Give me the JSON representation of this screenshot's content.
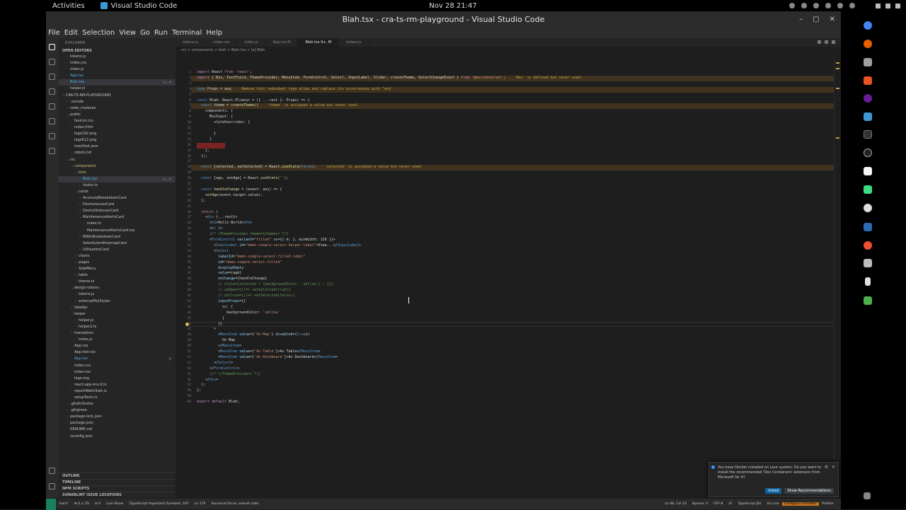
{
  "topbar": {
    "activities": "Activities",
    "app_name": "Visual Studio Code",
    "clock": "Nov 28  21:47"
  },
  "window": {
    "title": "Blah.tsx - cra-ts-rm-playground - Visual Studio Code",
    "menu": [
      "File",
      "Edit",
      "Selection",
      "View",
      "Go",
      "Run",
      "Terminal",
      "Help"
    ]
  },
  "sidebar": {
    "title": "EXPLORER",
    "open_editors": "OPEN EDITORS",
    "project": "CRA-TS-RM-PLAYGROUND",
    "tree": [
      {
        "name": "tokens.js",
        "indent": 1,
        "cls": ""
      },
      {
        "name": "index.css",
        "indent": 1,
        "cls": ""
      },
      {
        "name": "index.js",
        "indent": 1,
        "cls": ""
      },
      {
        "name": "App.tsx",
        "indent": 1,
        "cls": "tsx"
      },
      {
        "name": "Blah.tsx",
        "indent": 1,
        "cls": "tsx sel",
        "badge": "9+, M"
      },
      {
        "name": "helper.js",
        "indent": 1,
        "cls": ""
      },
      {
        "name": "CRA-TS-RM-PLAYGROUND",
        "indent": 0,
        "cls": "",
        "tw": "v"
      },
      {
        "name": ".vscode",
        "indent": 1,
        "cls": "",
        "tw": ">"
      },
      {
        "name": "node_modules",
        "indent": 1,
        "cls": "",
        "tw": ">"
      },
      {
        "name": "public",
        "indent": 1,
        "cls": "",
        "tw": "v"
      },
      {
        "name": "favicon.ico",
        "indent": 2,
        "cls": ""
      },
      {
        "name": "index.html",
        "indent": 2,
        "cls": ""
      },
      {
        "name": "logo192.png",
        "indent": 2,
        "cls": ""
      },
      {
        "name": "logo512.png",
        "indent": 2,
        "cls": ""
      },
      {
        "name": "manifest.json",
        "indent": 2,
        "cls": ""
      },
      {
        "name": "robots.txt",
        "indent": 2,
        "cls": ""
      },
      {
        "name": "src",
        "indent": 1,
        "cls": "mod",
        "tw": "v"
      },
      {
        "name": "components",
        "indent": 2,
        "cls": "mod",
        "tw": "v"
      },
      {
        "name": "blah",
        "indent": 3,
        "cls": "mod",
        "tw": "v"
      },
      {
        "name": "Blah.tsx",
        "indent": 4,
        "cls": "tsx sel",
        "badge": "9+, M"
      },
      {
        "name": "hooks.ts",
        "indent": 4,
        "cls": ""
      },
      {
        "name": "cards",
        "indent": 3,
        "cls": "",
        "tw": "v"
      },
      {
        "name": "AnomalyBreakdownCard",
        "indent": 4,
        "cls": "",
        "tw": ">"
      },
      {
        "name": "DeviceIssuesCard",
        "indent": 4,
        "cls": "",
        "tw": ">"
      },
      {
        "name": "DeviceStatusesCard",
        "indent": 4,
        "cls": "",
        "tw": ">"
      },
      {
        "name": "MaintenanceAlertsCard",
        "indent": 4,
        "cls": "",
        "tw": "v"
      },
      {
        "name": "index.ts",
        "indent": 5,
        "cls": ""
      },
      {
        "name": "MaintenanceAlertsCard.tsx",
        "indent": 5,
        "cls": ""
      },
      {
        "name": "NWInBreakdownCard",
        "indent": 4,
        "cls": "",
        "tw": ">"
      },
      {
        "name": "SalesSubmitteamapCard",
        "indent": 4,
        "cls": "",
        "tw": ">"
      },
      {
        "name": "UtilisationCard",
        "indent": 4,
        "cls": "",
        "tw": ">"
      },
      {
        "name": "charts",
        "indent": 3,
        "cls": "",
        "tw": ">"
      },
      {
        "name": "pages",
        "indent": 3,
        "cls": "",
        "tw": ">"
      },
      {
        "name": "SideMenu",
        "indent": 3,
        "cls": "",
        "tw": ">"
      },
      {
        "name": "table",
        "indent": 3,
        "cls": "",
        "tw": ">"
      },
      {
        "name": "theme.ts",
        "indent": 3,
        "cls": ""
      },
      {
        "name": "design-tokens",
        "indent": 2,
        "cls": "",
        "tw": "v"
      },
      {
        "name": "tokens.js",
        "indent": 3,
        "cls": ""
      },
      {
        "name": "externalMuiStyles",
        "indent": 3,
        "cls": "",
        "tw": ">"
      },
      {
        "name": "fakeApi",
        "indent": 2,
        "cls": "",
        "tw": ">"
      },
      {
        "name": "helper",
        "indent": 2,
        "cls": "",
        "tw": "v"
      },
      {
        "name": "helper.js",
        "indent": 3,
        "cls": ""
      },
      {
        "name": "helper2.ts",
        "indent": 3,
        "cls": ""
      },
      {
        "name": "translation",
        "indent": 2,
        "cls": "",
        "tw": ">"
      },
      {
        "name": "index.js",
        "indent": 3,
        "cls": ""
      },
      {
        "name": "App.css",
        "indent": 2,
        "cls": ""
      },
      {
        "name": "App.test.tsx",
        "indent": 2,
        "cls": ""
      },
      {
        "name": "App.tsx",
        "indent": 2,
        "cls": "tsx",
        "badge": "M"
      },
      {
        "name": "index.css",
        "indent": 2,
        "cls": ""
      },
      {
        "name": "index.tsx",
        "indent": 2,
        "cls": ""
      },
      {
        "name": "logo.svg",
        "indent": 2,
        "cls": ""
      },
      {
        "name": "react-app-env.d.ts",
        "indent": 2,
        "cls": ""
      },
      {
        "name": "reportWebVitals.ts",
        "indent": 2,
        "cls": ""
      },
      {
        "name": "setupTests.ts",
        "indent": 2,
        "cls": ""
      },
      {
        "name": ".gitattributes",
        "indent": 1,
        "cls": ""
      },
      {
        "name": ".gitignore",
        "indent": 1,
        "cls": ""
      },
      {
        "name": "package-lock.json",
        "indent": 1,
        "cls": ""
      },
      {
        "name": "package.json",
        "indent": 1,
        "cls": ""
      },
      {
        "name": "README.md",
        "indent": 1,
        "cls": ""
      },
      {
        "name": "tsconfig.json",
        "indent": 1,
        "cls": ""
      }
    ],
    "bottom_sections": [
      "OUTLINE",
      "TIMELINE",
      "NPM SCRIPTS",
      "SONARLINT ISSUE LOCATIONS"
    ]
  },
  "tabs": [
    {
      "label": "tokens.js",
      "active": false
    },
    {
      "label": "index.css",
      "active": false
    },
    {
      "label": "index.js",
      "active": false
    },
    {
      "label": "App.tsx M",
      "active": false
    },
    {
      "label": "Blah.tsx 9+, M",
      "active": true
    },
    {
      "label": "helper.js",
      "active": false
    }
  ],
  "breadcrumb": "src > components > blah > Blah.tsx > [e] Blah",
  "code": [
    {
      "n": 1,
      "html": "<span class='kw'>import</span> React <span class='kw'>from</span> <span class='str'>'react'</span>;"
    },
    {
      "n": 2,
      "warn": true,
      "html": "<span class='kw'>import</span> { Box, TextField, ThemeProvider, MenuItem, FormControl, Select, InputLabel, Slider, createTheme, SelectChangeEvent } <span class='kw'>from</span> <span class='str'>'@mui/material'</span>;    <span class='hint'>'Box' is defined but never used.</span>"
    },
    {
      "n": 3,
      "html": ""
    },
    {
      "n": 4,
      "warn": true,
      "html": "<span class='tag'>type</span> Props = any;    <span class='hint'>Remove this redundant type alias and replace its occurrences with \"any\"</span>"
    },
    {
      "n": 5,
      "html": ""
    },
    {
      "n": 6,
      "html": "<span class='tag'>const</span> <span class='fn'>Blah</span>: React.FC&lt;any&gt; = ({ ...rest }: Props) =&gt; {"
    },
    {
      "n": 7,
      "warn": true,
      "html": "  <span class='tag'>const</span> theme = <span class='fn'>createTheme</span>({    <span class='hint'>'theme' is assigned a value but never used.</span>"
    },
    {
      "n": 8,
      "html": "    components: {"
    },
    {
      "n": 9,
      "html": "      MuiInput: {"
    },
    {
      "n": 10,
      "html": "        styleOverrides: {"
    },
    {
      "n": 11,
      "html": ""
    },
    {
      "n": 12,
      "html": "        }"
    },
    {
      "n": 13,
      "html": "      }"
    },
    {
      "n": 14,
      "err": true,
      "html": ""
    },
    {
      "n": 15,
      "html": "    },"
    },
    {
      "n": 16,
      "html": "  });"
    },
    {
      "n": 17,
      "html": ""
    },
    {
      "n": 18,
      "warn": true,
      "html": "  <span class='tag'>const</span> [selected, setSelected] = React.<span class='fn'>useState</span>(<span class='tag'>false</span>);    <span class='hint'>'selected' is assigned a value but never used.</span>"
    },
    {
      "n": 19,
      "html": ""
    },
    {
      "n": 20,
      "html": "  <span class='tag'>const</span> [age, setAge] = React.<span class='fn'>useState</span>(<span class='str'>''</span>);"
    },
    {
      "n": 21,
      "html": ""
    },
    {
      "n": 22,
      "html": "  <span class='tag'>const</span> <span class='fn'>handleChange</span> = (event: any) =&gt; {"
    },
    {
      "n": 23,
      "html": "    <span class='fn'>setAge</span>(event.target.value);"
    },
    {
      "n": 24,
      "html": "  };"
    },
    {
      "n": 25,
      "html": ""
    },
    {
      "n": 26,
      "html": "  <span class='kw'>return</span> ("
    },
    {
      "n": 27,
      "html": "    &lt;<span class='tag'>div</span> {...rest}&gt;"
    },
    {
      "n": 28,
      "html": "      &lt;<span class='tag'>h1</span>&gt;Hello World&lt;/<span class='tag'>h1</span>&gt;"
    },
    {
      "n": 29,
      "html": "      &lt;<span class='tag'>br</span> /&gt;"
    },
    {
      "n": 30,
      "html": "      <span class='cmt'>{/* &lt;ThemeProvider theme={theme}&gt; */}</span>"
    },
    {
      "n": 31,
      "html": "      &lt;<span class='tag'>FormControl</span> <span class='var'>variant</span>=<span class='str'>\"filled\"</span> <span class='var'>sx</span>={{ m: 1, minWidth: 120 }}&gt;"
    },
    {
      "n": 32,
      "html": "        &lt;<span class='tag'>InputLabel</span> <span class='var'>id</span>=<span class='str'>\"demo-simple-select-helper-label\"</span>&gt;View...&lt;/<span class='tag'>InputLabel</span>&gt;"
    },
    {
      "n": 33,
      "html": "        &lt;<span class='tag'>Select</span>"
    },
    {
      "n": 34,
      "html": "          <span class='var'>labelId</span>=<span class='str'>\"demo-simple-select-filled-label\"</span>"
    },
    {
      "n": 35,
      "html": "          <span class='var'>id</span>=<span class='str'>\"demo-simple-select-filled\"</span>"
    },
    {
      "n": 36,
      "html": "          <span class='var'>displayEmpty</span>"
    },
    {
      "n": 37,
      "html": "          <span class='var'>value</span>={age}"
    },
    {
      "n": 38,
      "html": "          <span class='var'>onChange</span>={handleChange}"
    },
    {
      "n": 39,
      "html": "          <span class='cmt'>// style={selected ? {backgroundColor: 'yellow'} : {}}</span>"
    },
    {
      "n": 40,
      "html": "          <span class='cmt'>// onOpen={()=&gt; setSelected(true)}</span>"
    },
    {
      "n": 41,
      "html": "          <span class='cmt'>// onClose={()=&gt; setSelected(false)}</span>"
    },
    {
      "n": 42,
      "html": "          <span class='var'>inputProps</span>={{"
    },
    {
      "n": 43,
      "html": "            sx: {"
    },
    {
      "n": 44,
      "html": "              backgroundColor: <span class='str'>'yellow'</span>"
    },
    {
      "n": 45,
      "html": "            }"
    },
    {
      "n": 46,
      "cur": true,
      "html": "          }}"
    },
    {
      "n": 47,
      "html": "        &gt;"
    },
    {
      "n": 48,
      "html": "          &lt;<span class='tag'>MenuItem</span> <span class='var'>value</span>={<span class='str'>'On Map'</span>} <span class='var'>disabled</span>={<span class='tag'>true</span>}&gt;"
    },
    {
      "n": 49,
      "html": "            On Map"
    },
    {
      "n": 50,
      "html": "          &lt;/<span class='tag'>MenuItem</span>&gt;"
    },
    {
      "n": 51,
      "html": "          &lt;<span class='tag'>MenuItem</span> <span class='var'>value</span>={<span class='str'>'As Table'</span>}&gt;As Table&lt;/<span class='tag'>MenuItem</span>&gt;"
    },
    {
      "n": 52,
      "html": "          &lt;<span class='tag'>MenuItem</span> <span class='var'>value</span>={<span class='str'>'As Dashboard'</span>}&gt;As Dashboard&lt;/<span class='tag'>MenuItem</span>&gt;"
    },
    {
      "n": 53,
      "html": "        &lt;/<span class='tag'>Select</span>&gt;"
    },
    {
      "n": 54,
      "html": "      &lt;/<span class='tag'>FormControl</span>&gt;"
    },
    {
      "n": 55,
      "html": "      <span class='cmt'>{/* &lt;/ThemeProvider&gt; */}</span>"
    },
    {
      "n": 56,
      "html": "    &lt;/<span class='tag'>div</span>&gt;"
    },
    {
      "n": 57,
      "html": "  );"
    },
    {
      "n": 58,
      "html": "};"
    },
    {
      "n": 59,
      "html": ""
    },
    {
      "n": 60,
      "html": "<span class='kw'>export</span> <span class='kw'>default</span> Blah;"
    }
  ],
  "notification": {
    "message": "You have Docker installed on your system. Do you want to install the recommended 'Dev Containers' extension from Microsoft for it?",
    "install_label": "Install",
    "show_label": "Show Recommendations"
  },
  "statusbar": {
    "left": [
      "main*",
      "⊗ 0 ⚠ 25",
      "⊘ 0",
      "Live Share",
      "[TypeScript Important] Symbols: 107",
      "Ln 170",
      "SonarLint focus: overall code"
    ],
    "right": [
      "Ln 46, Col 23",
      "Spaces: 4",
      "UTF-8",
      "LF",
      "TypeScript JSX",
      "Go Live",
      "Configure Formatter",
      "Prettier"
    ],
    "highlight": "Configure Formatter"
  }
}
